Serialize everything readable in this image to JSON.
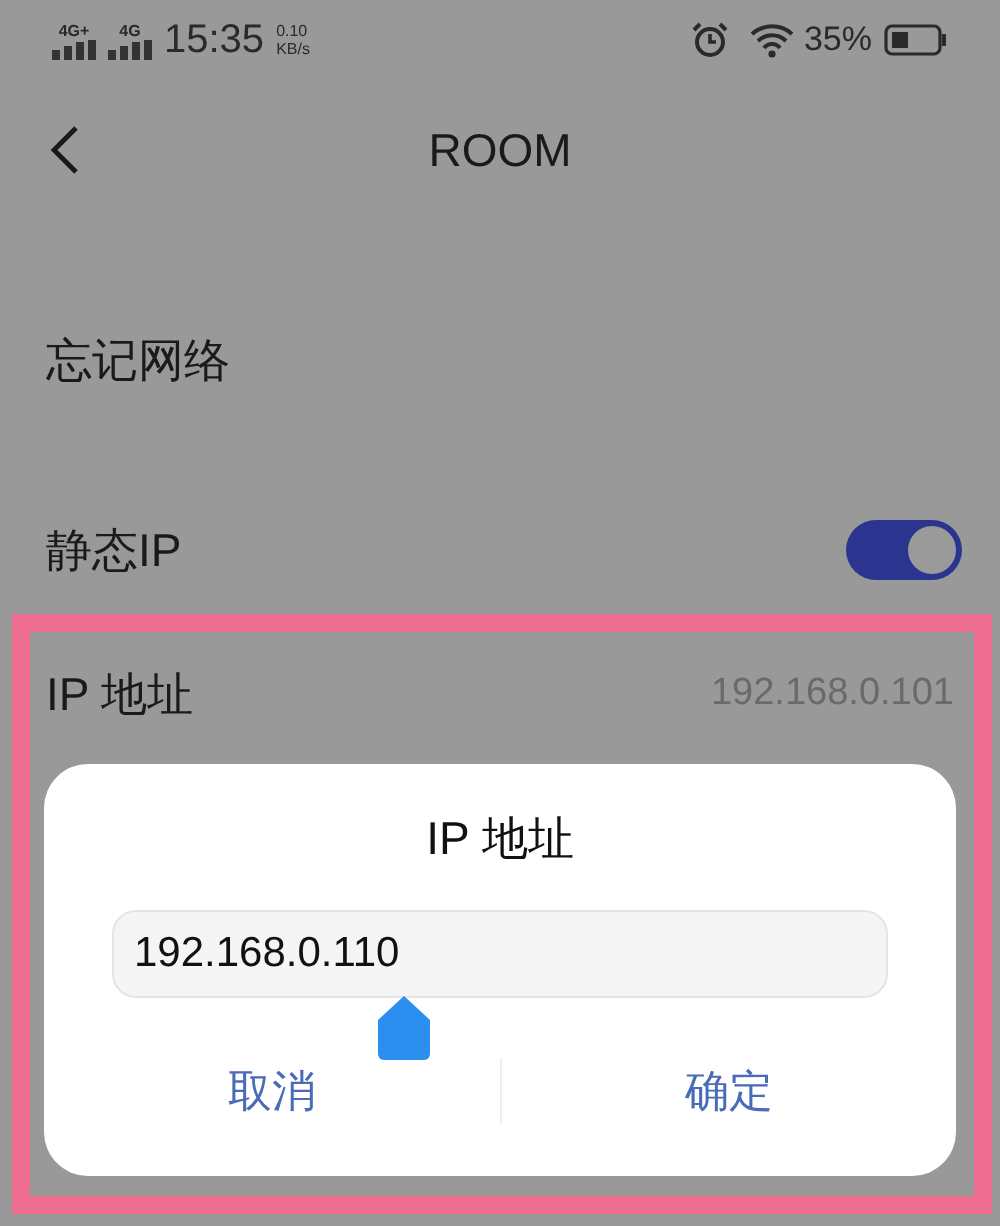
{
  "status_bar": {
    "signal_1": "4G+",
    "signal_2": "4G",
    "time": "15:35",
    "speed_value": "0.10",
    "speed_unit": "KB/s",
    "battery": "35%"
  },
  "header": {
    "title": "ROOM"
  },
  "settings": [
    {
      "kind": "link",
      "label": "忘记网络"
    },
    {
      "kind": "toggle",
      "label": "静态IP",
      "on": true
    },
    {
      "kind": "value",
      "label": "IP 地址",
      "value": "192.168.0.101"
    }
  ],
  "dialog": {
    "title": "IP 地址",
    "value": "192.168.0.110",
    "buttons": [
      "取消",
      "确定"
    ]
  }
}
